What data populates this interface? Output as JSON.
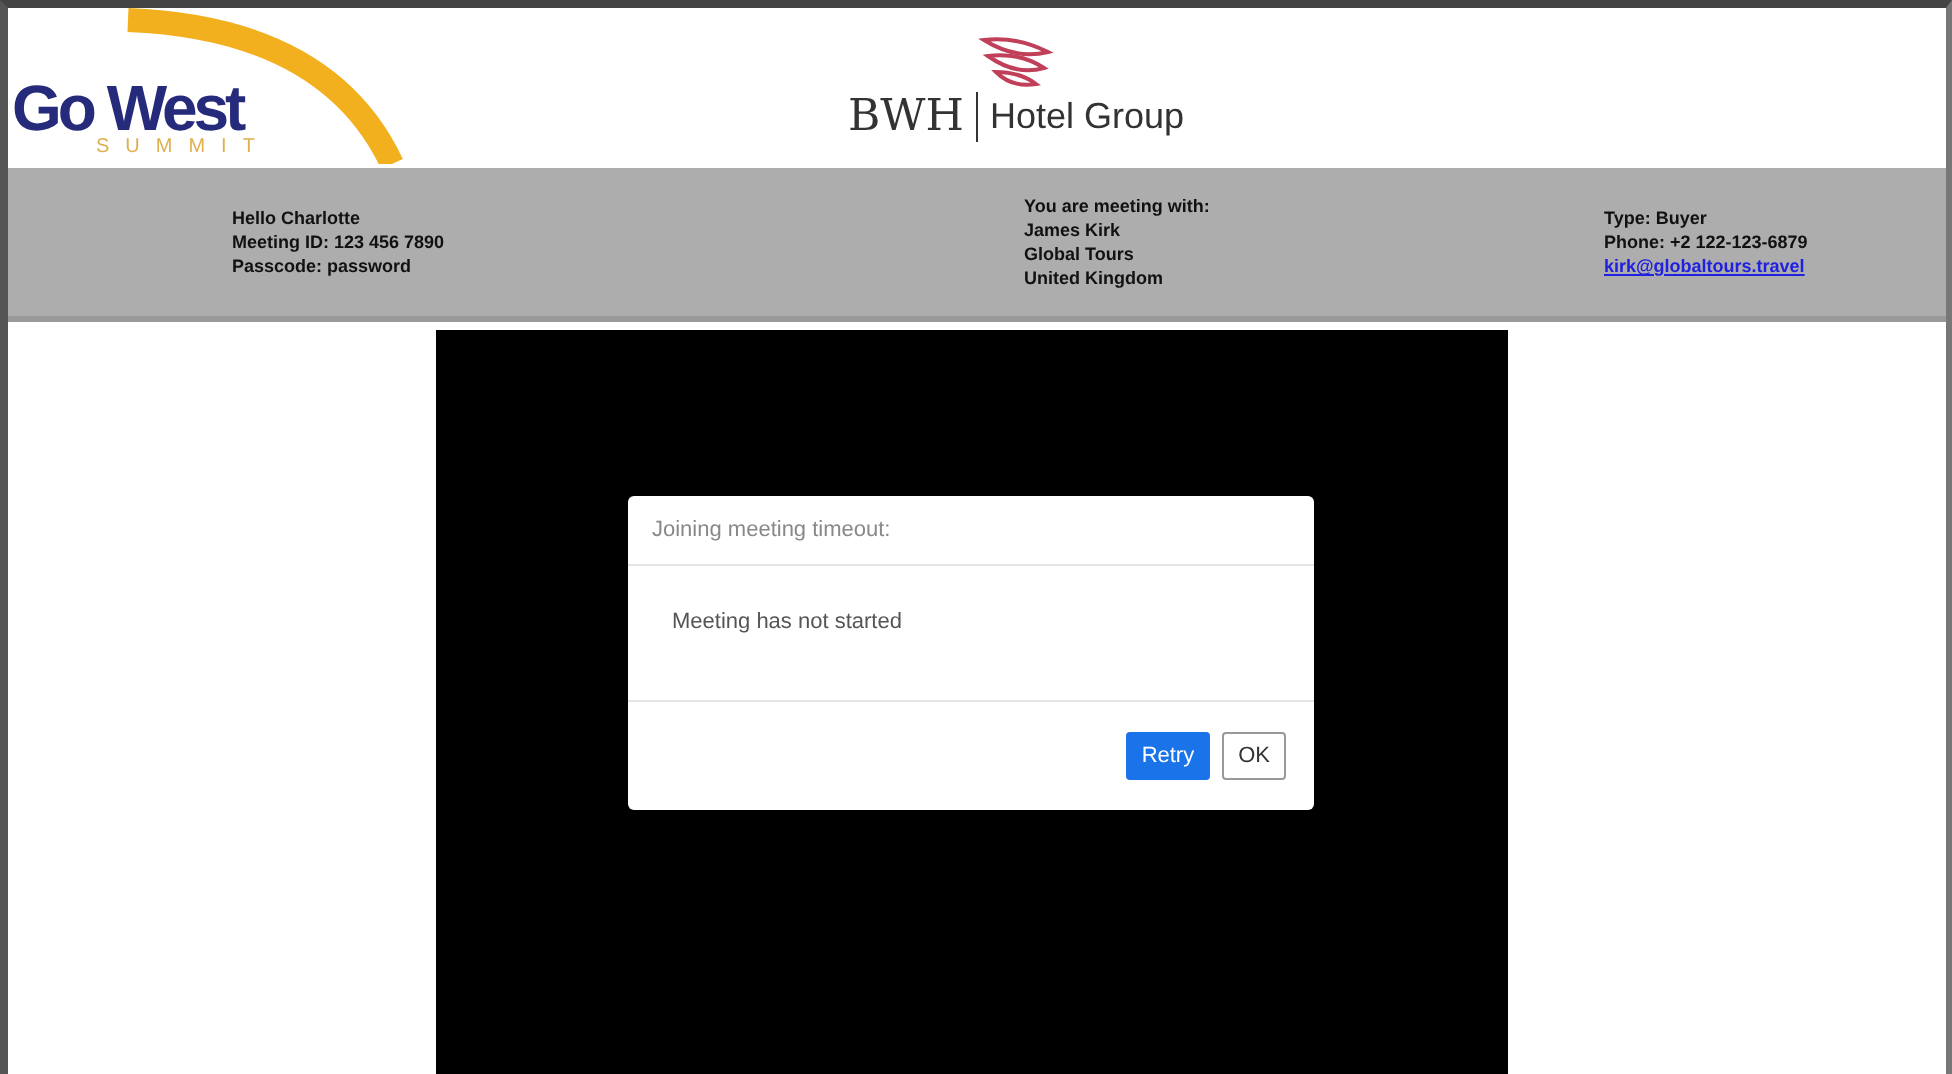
{
  "header": {
    "event_logo": {
      "title": "Go West",
      "subtitle": "SUMMIT"
    },
    "hotel_logo": {
      "brand": "BWH",
      "name": "Hotel Group"
    }
  },
  "info_bar": {
    "greeting": [
      "Hello Charlotte",
      "Meeting ID: 123 456 7890",
      "Passcode: password"
    ],
    "meeting_with": [
      "You are meeting with:",
      "James Kirk",
      "Global Tours",
      "United Kingdom"
    ],
    "contact": {
      "type": "Type: Buyer",
      "phone": "Phone: +2 122-123-6879",
      "email": "kirk@globaltours.travel"
    }
  },
  "dialog": {
    "title": "Joining meeting timeout:",
    "message": "Meeting has not started",
    "buttons": [
      {
        "label": "Retry",
        "kind": "primary"
      },
      {
        "label": "OK",
        "kind": "secondary"
      }
    ]
  }
}
